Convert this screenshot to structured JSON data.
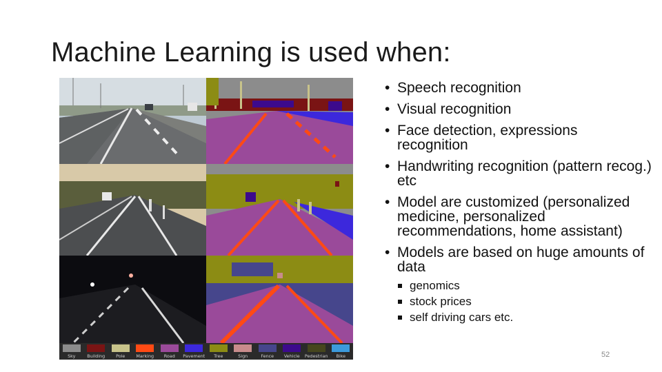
{
  "slide": {
    "title": "Machine Learning is used when:",
    "page_number": "52"
  },
  "figure": {
    "description_icon": "road-segmentation-image",
    "legend": [
      {
        "label": "Sky",
        "color": "#8c8c8c"
      },
      {
        "label": "Building",
        "color": "#7a1414"
      },
      {
        "label": "Pole",
        "color": "#c8c38a"
      },
      {
        "label": "Marking",
        "color": "#ff4a14"
      },
      {
        "label": "Road",
        "color": "#9a4a9a"
      },
      {
        "label": "Pavement",
        "color": "#3c28dc"
      },
      {
        "label": "Tree",
        "color": "#8c8c14"
      },
      {
        "label": "Sign",
        "color": "#c88c8c"
      },
      {
        "label": "Fence",
        "color": "#46468c"
      },
      {
        "label": "Vehicle",
        "color": "#3c0a8c"
      },
      {
        "label": "Pedestrian",
        "color": "#46461e"
      },
      {
        "label": "Bike",
        "color": "#3c9adc"
      }
    ]
  },
  "bullets": [
    {
      "text": "Speech recognition"
    },
    {
      "text": "Visual recognition"
    },
    {
      "text": "Face detection, expressions recognition"
    },
    {
      "text": "Handwriting recognition (pattern recog.) etc"
    },
    {
      "text": "Model are customized (personalized medicine, personalized recommendations, home assistant)"
    },
    {
      "text": "Models are based on huge amounts of data",
      "sub": [
        "genomics",
        "stock prices",
        "self driving cars etc."
      ]
    }
  ]
}
